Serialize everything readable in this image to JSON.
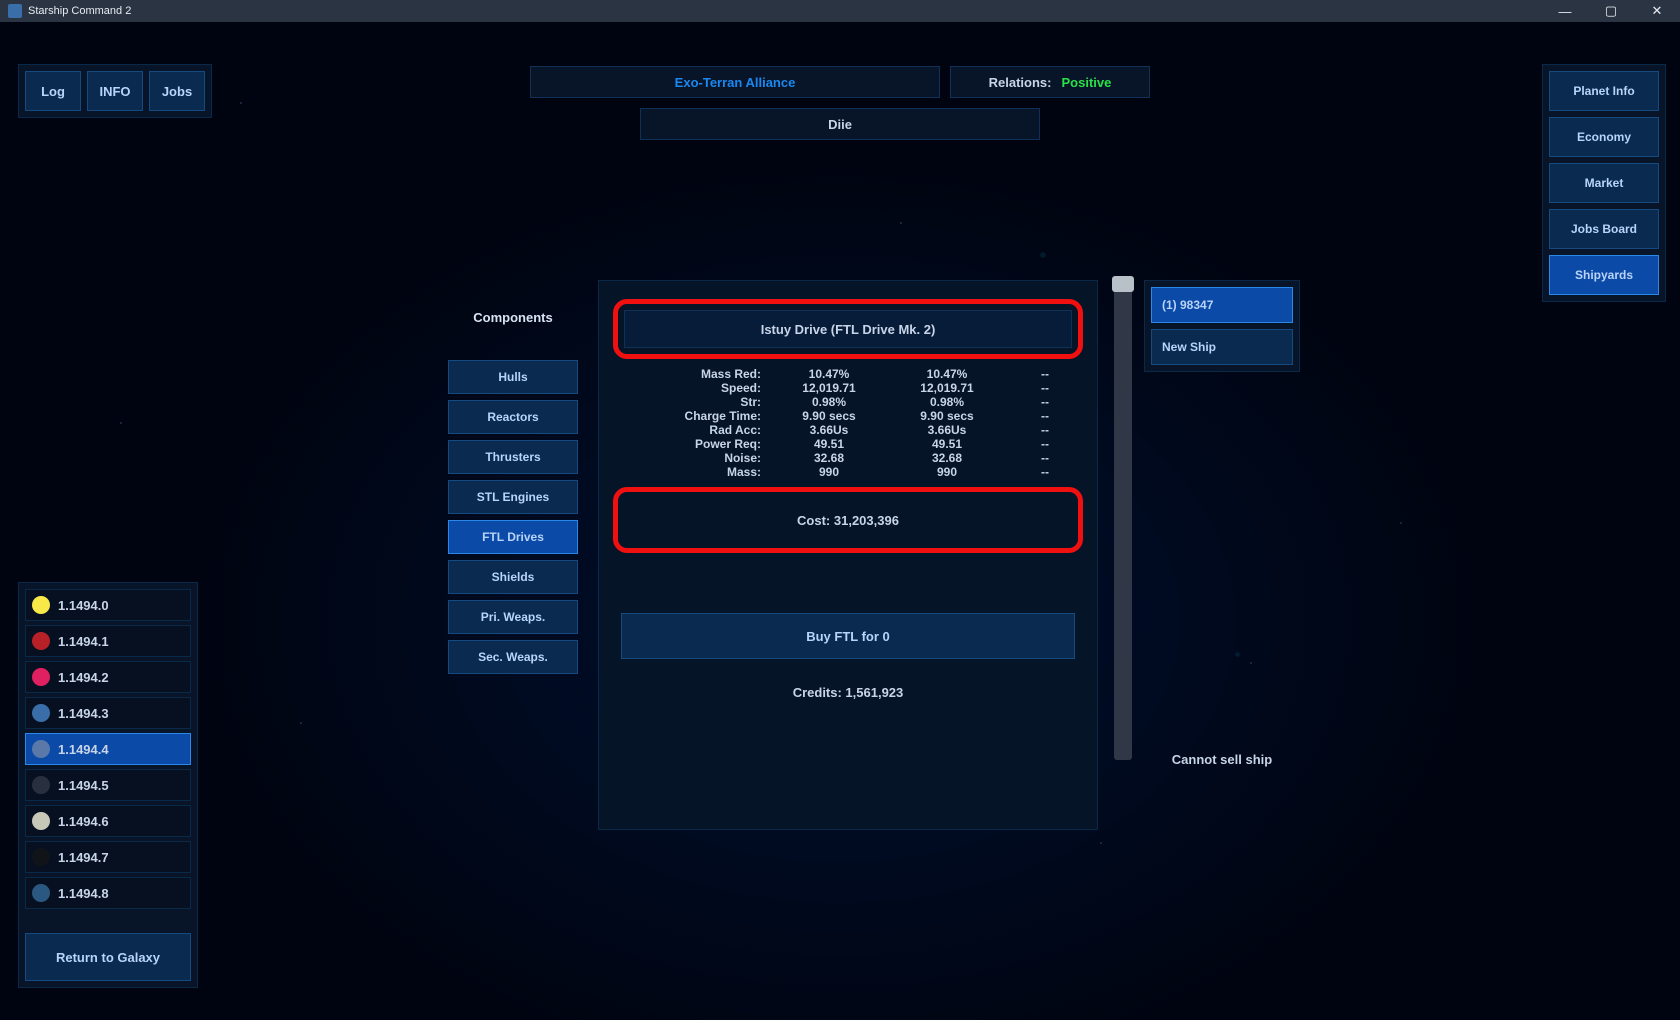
{
  "window": {
    "title": "Starship Command 2"
  },
  "top_left": {
    "buttons": [
      "Log",
      "INFO",
      "Jobs"
    ]
  },
  "top_right": {
    "buttons": [
      "Planet Info",
      "Economy",
      "Market",
      "Jobs Board",
      "Shipyards"
    ],
    "active": 4
  },
  "header": {
    "faction": "Exo-Terran Alliance",
    "relations_label": "Relations:",
    "relations_value": "Positive",
    "location": "Diie"
  },
  "systems": {
    "items": [
      {
        "label": "1.1494.0",
        "color": "#f8e848"
      },
      {
        "label": "1.1494.1",
        "color": "#b82028"
      },
      {
        "label": "1.1494.2",
        "color": "#e02060"
      },
      {
        "label": "1.1494.3",
        "color": "#3a6ea8"
      },
      {
        "label": "1.1494.4",
        "color": "#5a78a8"
      },
      {
        "label": "1.1494.5",
        "color": "#283040"
      },
      {
        "label": "1.1494.6",
        "color": "#c8c8b8"
      },
      {
        "label": "1.1494.7",
        "color": "#101418"
      },
      {
        "label": "1.1494.8",
        "color": "#2a5880"
      }
    ],
    "selected": 4,
    "return": "Return to Galaxy"
  },
  "shipyard": {
    "components_label": "Components",
    "categories": [
      "Hulls",
      "Reactors",
      "Thrusters",
      "STL Engines",
      "FTL Drives",
      "Shields",
      "Pri. Weaps.",
      "Sec. Weaps."
    ],
    "category_active": 4,
    "item_name": "Istuy Drive (FTL Drive Mk. 2)",
    "stats": [
      {
        "label": "Mass Red:",
        "a": "10.47%",
        "b": "10.47%",
        "c": "--"
      },
      {
        "label": "Speed:",
        "a": "12,019.71",
        "b": "12,019.71",
        "c": "--"
      },
      {
        "label": "Str:",
        "a": "0.98%",
        "b": "0.98%",
        "c": "--"
      },
      {
        "label": "Charge Time:",
        "a": "9.90 secs",
        "b": "9.90 secs",
        "c": "--"
      },
      {
        "label": "Rad Acc:",
        "a": "3.66Us",
        "b": "3.66Us",
        "c": "--"
      },
      {
        "label": "Power Req:",
        "a": "49.51",
        "b": "49.51",
        "c": "--"
      },
      {
        "label": "Noise:",
        "a": "32.68",
        "b": "32.68",
        "c": "--"
      },
      {
        "label": "Mass:",
        "a": "990",
        "b": "990",
        "c": "--"
      }
    ],
    "cost": "Cost: 31,203,396",
    "buy": "Buy FTL for 0",
    "credits": "Credits: 1,561,923",
    "ships": [
      "(1) 98347",
      "New Ship"
    ],
    "ship_active": 0,
    "sell_note": "Cannot sell ship"
  }
}
